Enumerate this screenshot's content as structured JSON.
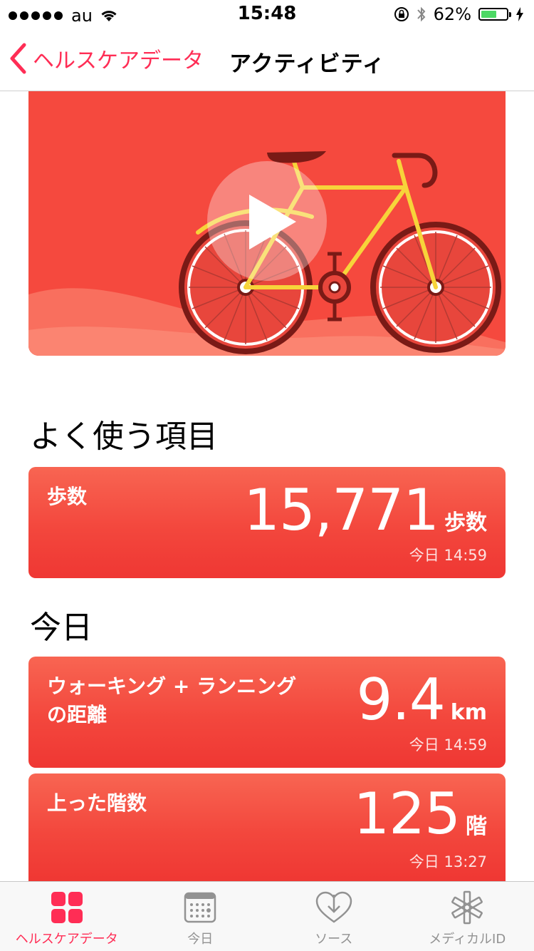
{
  "status_bar": {
    "carrier": "au",
    "time": "15:48",
    "battery_percent": "62%",
    "battery_level": 0.62
  },
  "nav": {
    "back_label": "ヘルスケアデータ",
    "title": "アクティビティ"
  },
  "sections": {
    "favorites_title": "よく使う項目",
    "today_title": "今日"
  },
  "cards": [
    {
      "label": "歩数",
      "value": "15,771",
      "unit": "歩数",
      "time": "今日 14:59"
    },
    {
      "label": "ウォーキング + ランニング\nの距離",
      "value": "9.4",
      "unit": "km",
      "time": "今日 14:59"
    },
    {
      "label": "上った階数",
      "value": "125",
      "unit": "階",
      "time": "今日 13:27"
    }
  ],
  "tabs": [
    {
      "label": "ヘルスケアデータ",
      "icon": "health-data-grid-icon",
      "active": true
    },
    {
      "label": "今日",
      "icon": "calendar-icon",
      "active": false
    },
    {
      "label": "ソース",
      "icon": "sources-heart-icon",
      "active": false
    },
    {
      "label": "メディカルID",
      "icon": "medical-id-asterisk-icon",
      "active": false
    }
  ],
  "colors": {
    "accent": "#ff2d55",
    "card_red": "#f3473d",
    "hero_red": "#f5493e",
    "bike_yellow": "#f7d43a"
  }
}
